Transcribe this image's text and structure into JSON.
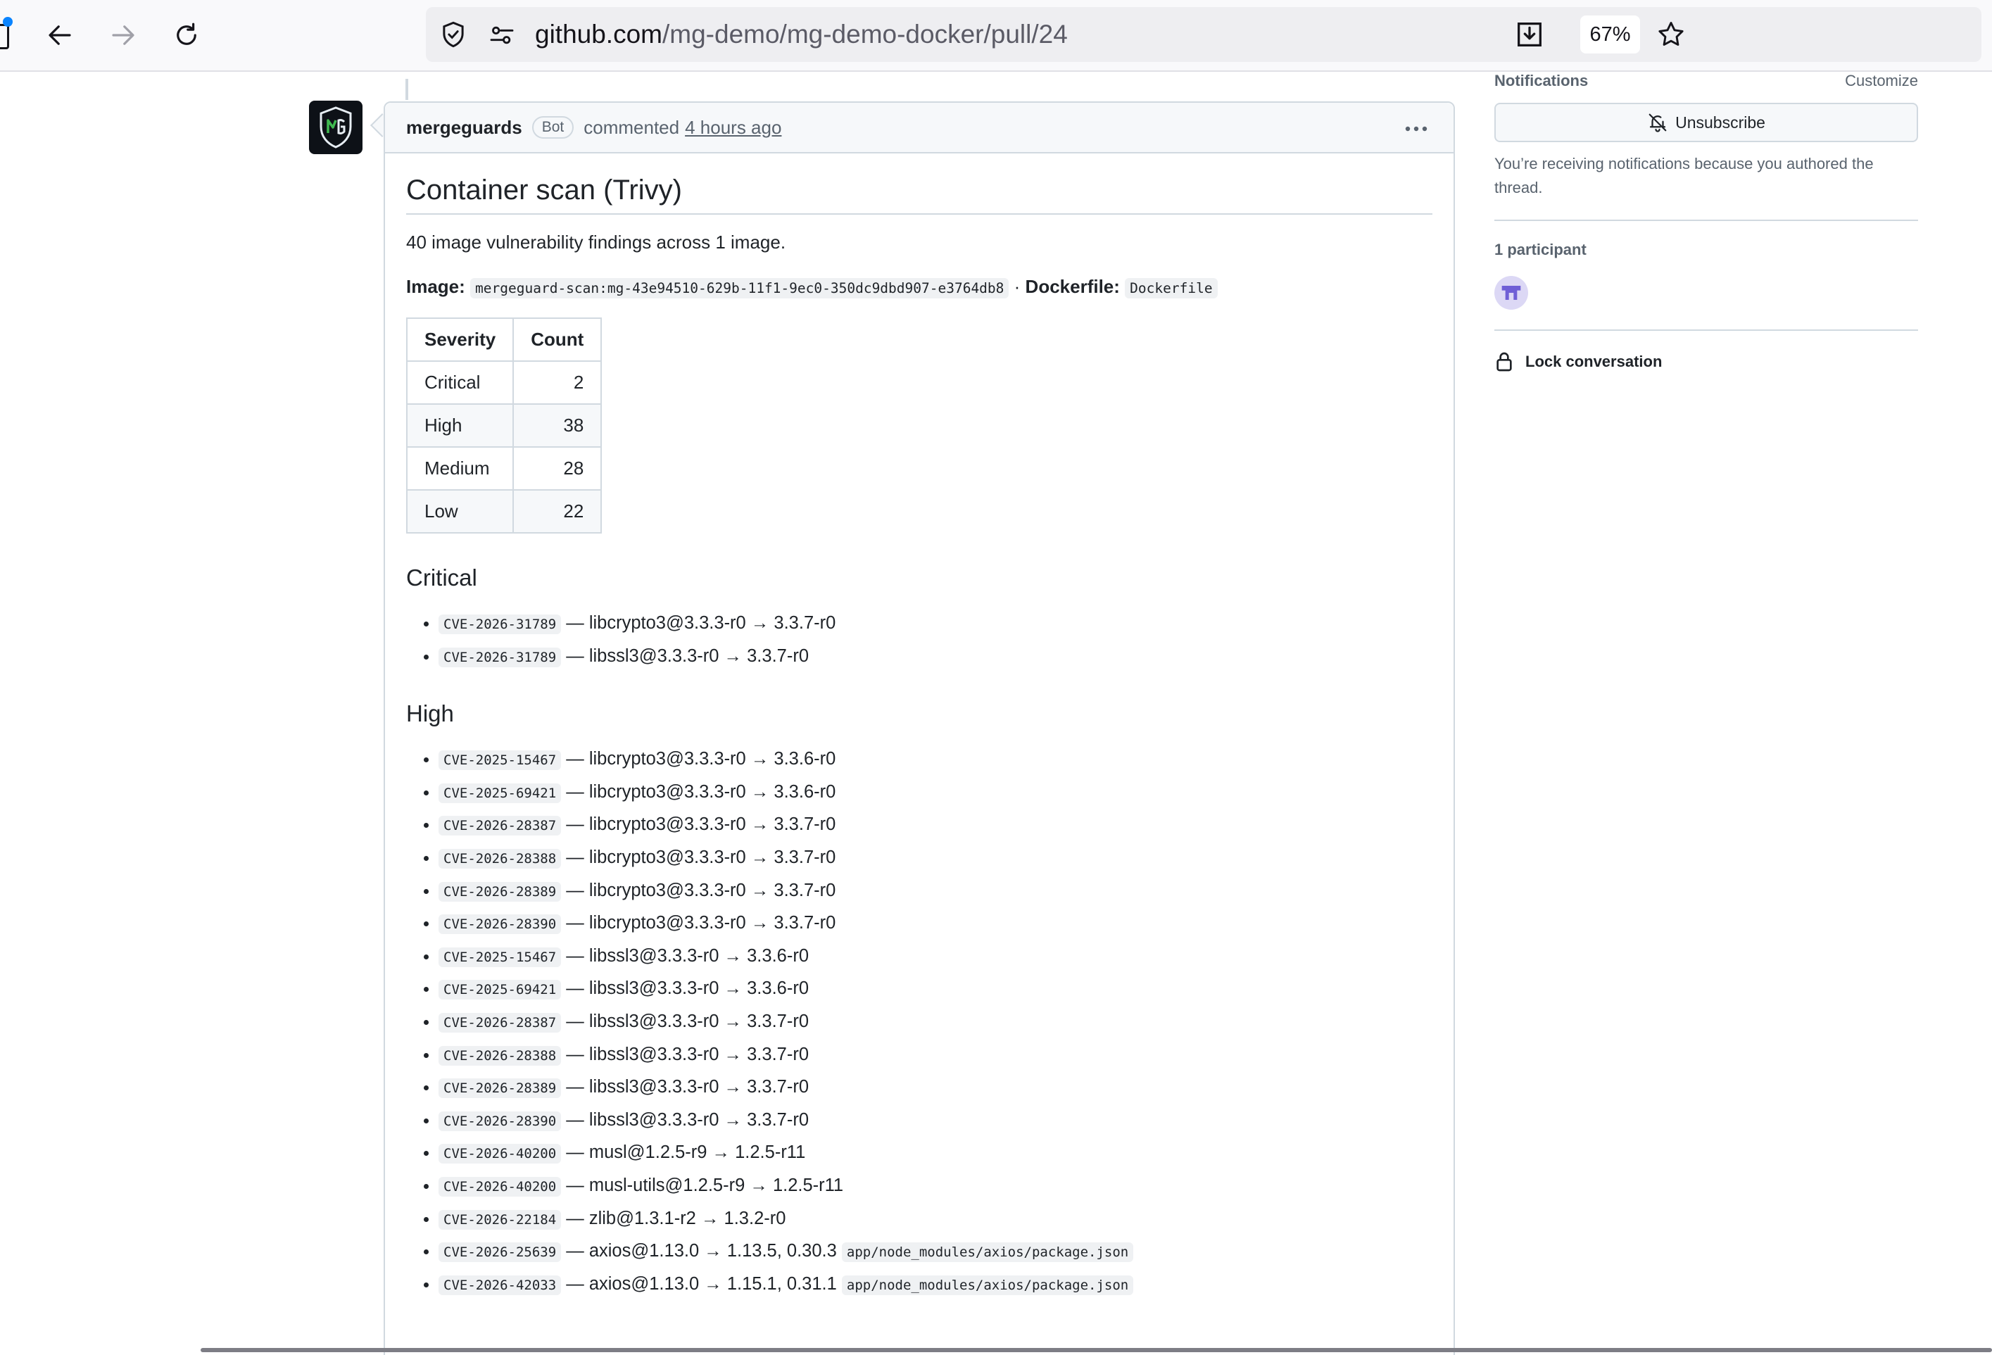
{
  "browser": {
    "url_host": "github.com",
    "url_path": "/mg-demo/mg-demo-docker/pull/24",
    "zoom": "67%"
  },
  "comment": {
    "author": "mergeguards",
    "badge": "Bot",
    "action": "commented",
    "time_ago": "4 hours ago",
    "title": "Container scan (Trivy)",
    "summary": "40 image vulnerability findings across 1 image.",
    "image_label": "Image:",
    "image_value": "mergeguard-scan:mg-43e94510-629b-11f1-9ec0-350dc9dbd907-e3764db8",
    "separator": "·",
    "dockerfile_label": "Dockerfile:",
    "dockerfile_value": "Dockerfile",
    "table": {
      "headers": [
        "Severity",
        "Count"
      ],
      "rows": [
        {
          "severity": "Critical",
          "count": "2"
        },
        {
          "severity": "High",
          "count": "38"
        },
        {
          "severity": "Medium",
          "count": "28"
        },
        {
          "severity": "Low",
          "count": "22"
        }
      ]
    },
    "sections": [
      {
        "heading": "Critical",
        "items": [
          {
            "cve": "CVE-2026-31789",
            "text": "— libcrypto3@3.3.3-r0 → 3.3.7-r0",
            "path": ""
          },
          {
            "cve": "CVE-2026-31789",
            "text": "— libssl3@3.3.3-r0 → 3.3.7-r0",
            "path": ""
          }
        ]
      },
      {
        "heading": "High",
        "items": [
          {
            "cve": "CVE-2025-15467",
            "text": "— libcrypto3@3.3.3-r0 → 3.3.6-r0",
            "path": ""
          },
          {
            "cve": "CVE-2025-69421",
            "text": "— libcrypto3@3.3.3-r0 → 3.3.6-r0",
            "path": ""
          },
          {
            "cve": "CVE-2026-28387",
            "text": "— libcrypto3@3.3.3-r0 → 3.3.7-r0",
            "path": ""
          },
          {
            "cve": "CVE-2026-28388",
            "text": "— libcrypto3@3.3.3-r0 → 3.3.7-r0",
            "path": ""
          },
          {
            "cve": "CVE-2026-28389",
            "text": "— libcrypto3@3.3.3-r0 → 3.3.7-r0",
            "path": ""
          },
          {
            "cve": "CVE-2026-28390",
            "text": "— libcrypto3@3.3.3-r0 → 3.3.7-r0",
            "path": ""
          },
          {
            "cve": "CVE-2025-15467",
            "text": "— libssl3@3.3.3-r0 → 3.3.6-r0",
            "path": ""
          },
          {
            "cve": "CVE-2025-69421",
            "text": "— libssl3@3.3.3-r0 → 3.3.6-r0",
            "path": ""
          },
          {
            "cve": "CVE-2026-28387",
            "text": "— libssl3@3.3.3-r0 → 3.3.7-r0",
            "path": ""
          },
          {
            "cve": "CVE-2026-28388",
            "text": "— libssl3@3.3.3-r0 → 3.3.7-r0",
            "path": ""
          },
          {
            "cve": "CVE-2026-28389",
            "text": "— libssl3@3.3.3-r0 → 3.3.7-r0",
            "path": ""
          },
          {
            "cve": "CVE-2026-28390",
            "text": "— libssl3@3.3.3-r0 → 3.3.7-r0",
            "path": ""
          },
          {
            "cve": "CVE-2026-40200",
            "text": "— musl@1.2.5-r9 → 1.2.5-r11",
            "path": ""
          },
          {
            "cve": "CVE-2026-40200",
            "text": "— musl-utils@1.2.5-r9 → 1.2.5-r11",
            "path": ""
          },
          {
            "cve": "CVE-2026-22184",
            "text": "— zlib@1.3.1-r2 → 1.3.2-r0",
            "path": ""
          },
          {
            "cve": "CVE-2026-25639",
            "text": "— axios@1.13.0 → 1.13.5, 0.30.3",
            "path": "app/node_modules/axios/package.json"
          },
          {
            "cve": "CVE-2026-42033",
            "text": "— axios@1.13.0 → 1.15.1, 0.31.1",
            "path": "app/node_modules/axios/package.json"
          }
        ]
      }
    ]
  },
  "sidebar": {
    "notifications_heading": "Notifications",
    "customize_label": "Customize",
    "unsubscribe_label": "Unsubscribe",
    "notif_reason": "You’re receiving notifications because you authored the thread.",
    "participants_heading": "1 participant",
    "lock_label": "Lock conversation"
  },
  "colors": {
    "border": "#d1d9e0",
    "muted": "#59636e",
    "code_bg": "#eff1f3",
    "header_bg": "#f6f8fa",
    "participant_avatar": "#6f5fd6"
  }
}
